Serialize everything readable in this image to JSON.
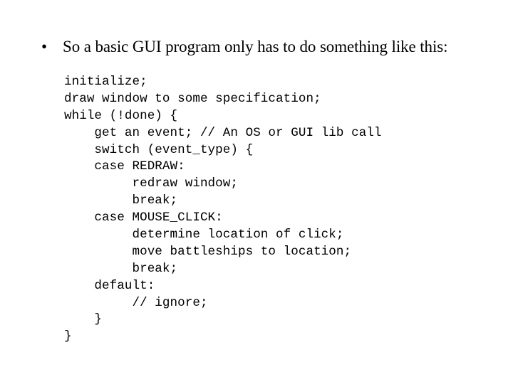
{
  "slide": {
    "background_color": "#ffffff",
    "text_color": "#000000"
  },
  "bullet": {
    "marker": "•",
    "text": "So a basic GUI program only has to do something like this:"
  },
  "code": {
    "language": "pseudocode",
    "lines": [
      "initialize;",
      "draw window to some specification;",
      "while (!done) {",
      "    get an event; // An OS or GUI lib call",
      "    switch (event_type) {",
      "    case REDRAW:",
      "         redraw window;",
      "         break;",
      "    case MOUSE_CLICK:",
      "         determine location of click;",
      "         move battleships to location;",
      "         break;",
      "    default:",
      "         // ignore;",
      "    }",
      "}"
    ]
  }
}
